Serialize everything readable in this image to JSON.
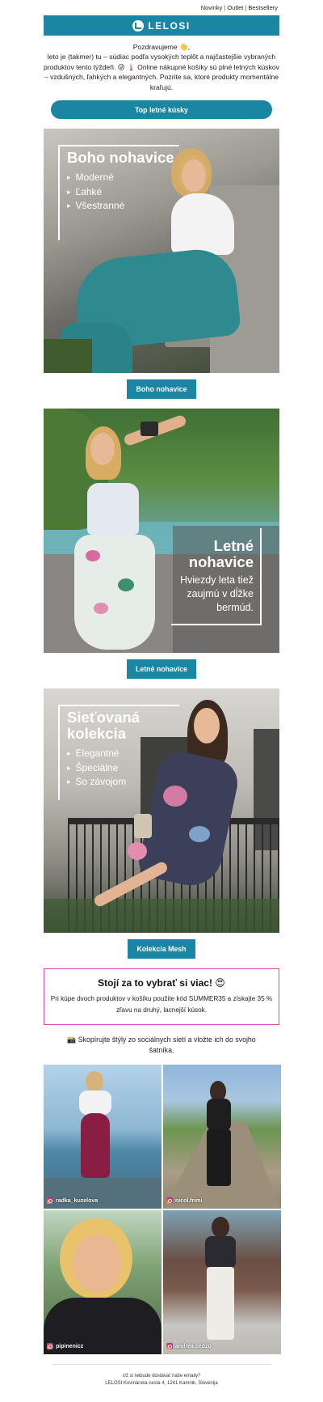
{
  "topnav": {
    "items": [
      "Novinky",
      "Outlet",
      "Bestsellery"
    ]
  },
  "logo": {
    "text": "LELOSI",
    "icon": "lelosi-logo-icon"
  },
  "intro": {
    "greeting": "Pozdravujeme 👋,",
    "body": "leto je (takmer) tu – súdiac podľa vysokých teplôt a najčastejšie vybraných produktov tento týždeň. 😜 🌡️ Online nákupné košíky sú plné letných kúskov – vzdušných, ľahkých a elegantných. Pozrite sa, ktoré produkty momentálne kraľujú."
  },
  "cta": {
    "label": "Top letné kúsky"
  },
  "banners": [
    {
      "title": "Boho nohavice",
      "items": [
        "Moderné",
        "Ľahké",
        "Všestranné"
      ],
      "button": "Boho nohavice"
    },
    {
      "title_line1": "Letné",
      "title_line2": "nohavice",
      "subtitle_line1": "Hviezdy leta tiež",
      "subtitle_line2": "zaujmú v dĺžke",
      "subtitle_line3": "bermúd.",
      "button": "Letné nohavice"
    },
    {
      "title_line1": "Sieťovaná",
      "title_line2": "kolekcia",
      "items": [
        "Elegantné",
        "Špeciálne",
        "So závojom"
      ],
      "button": "Kolekcia Mesh"
    }
  ],
  "promo": {
    "title": "Stojí za to vybrať si viac! 😍",
    "text": "Pri kúpe dvoch produktov v košíku použite kód SUMMER35 a získajte 35 % zľavu na druhý, lacnejší kúsok."
  },
  "social": {
    "text": "📸 Skopírujte štýly zo sociálnych sietí a vložte ich do svojho šatníka."
  },
  "instagram": [
    {
      "handle": "radka_kuzelova"
    },
    {
      "handle": "nicol.frimi"
    },
    {
      "handle": "pipinenicz"
    },
    {
      "handle": "andrea.cedzo"
    }
  ],
  "footer": {
    "line1": "Už si nebude dostávať naše emaily?",
    "line2": "LELOSI Kovinárska cesta 4, 1241 Kamnik, Slovenija"
  },
  "colors": {
    "brand": "#1a86a3",
    "promo_border": "#d64ab0"
  }
}
